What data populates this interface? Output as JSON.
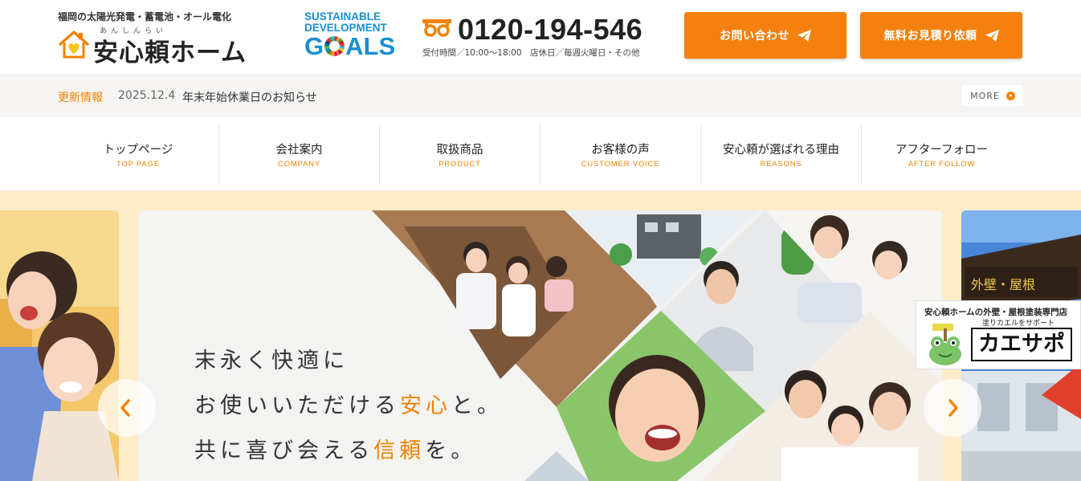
{
  "header": {
    "logo_tagline": "福岡の太陽光発電・蓄電池・オール電化",
    "logo_ruby": "あんしんらい",
    "logo_name": "安心頼ホーム",
    "sdgs": {
      "line1": "SUSTAINABLE",
      "line2": "DEVELOPMENT",
      "goals_g": "G",
      "goals_rest": "ALS"
    },
    "phone": {
      "number": "0120-194-546",
      "hours": "受付時間／10:00〜18:00　店休日／毎週火曜日・その他"
    },
    "contact_button": "お問い合わせ",
    "estimate_button": "無料お見積り依頼"
  },
  "news": {
    "label": "更新情報",
    "date": "2025.12.4",
    "title": "年末年始休業日のお知らせ",
    "more": "MORE"
  },
  "nav": [
    {
      "ja": "トップページ",
      "en": "TOP PAGE"
    },
    {
      "ja": "会社案内",
      "en": "COMPANY"
    },
    {
      "ja": "取扱商品",
      "en": "PRODUCT"
    },
    {
      "ja": "お客様の声",
      "en": "CUSTOMER VOICE"
    },
    {
      "ja": "安心頼が選ばれる理由",
      "en": "REASONS"
    },
    {
      "ja": "アフターフォロー",
      "en": "AFTER FOLLOW"
    }
  ],
  "hero": {
    "line1": "末永く快適に",
    "line2_pre": "お使いいただける",
    "line2_em": "安心",
    "line2_post": "と。",
    "line3_pre": "共に喜び会える",
    "line3_em": "信頼",
    "line3_post": "を。"
  },
  "banner": {
    "line1": "安心頼ホームの外壁・屋根塗装専門店",
    "line2": "塗りカエルをサポート",
    "name": "カエサポ"
  },
  "colors": {
    "accent": "#f08300",
    "button": "#f4810f",
    "sdgs_blue": "#1a8fd0",
    "hero_bg": "#fdecc8",
    "news_bg": "#f5f4f2"
  },
  "icons": {
    "send": "paper-plane-icon",
    "freedial": "freedial-icon",
    "arrows": [
      "chevron-left-icon",
      "chevron-right-icon"
    ]
  }
}
